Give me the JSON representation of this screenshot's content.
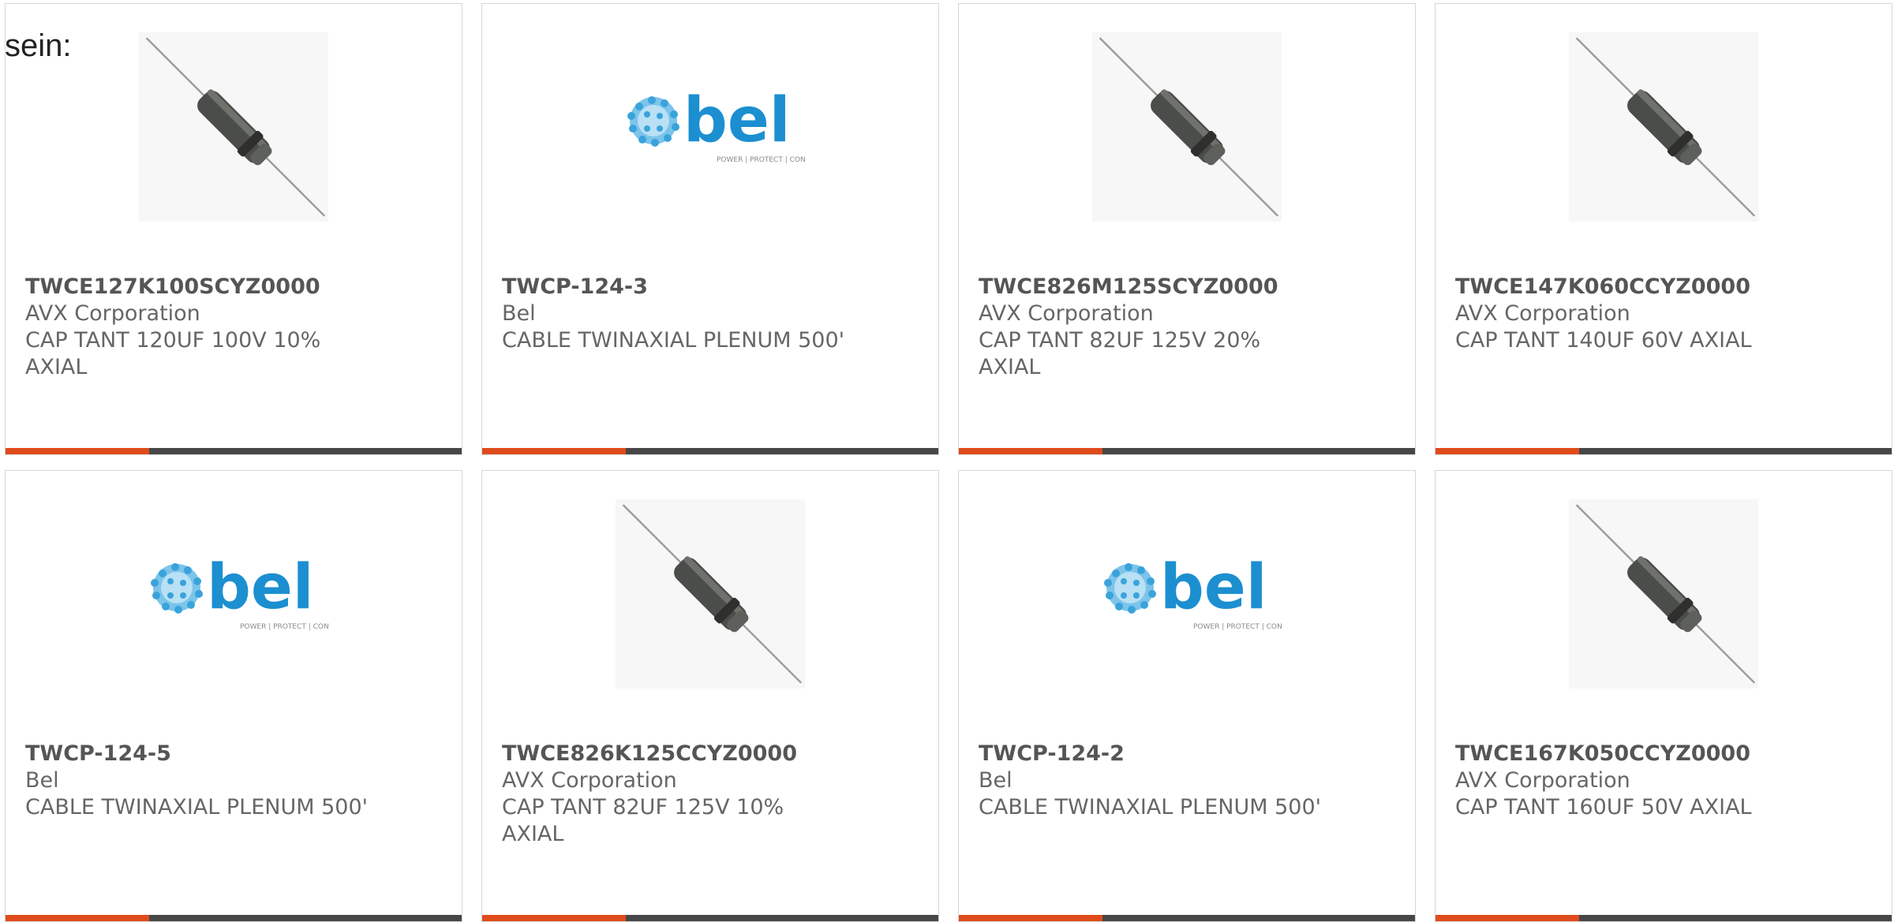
{
  "intro_text": "sein:",
  "colors": {
    "accent": "#e04b1c",
    "bar_dark": "#474747",
    "bel_blue": "#1c8fd1"
  },
  "cards": [
    {
      "part_number": "TWCE127K100SCYZ0000",
      "manufacturer": "AVX Corporation",
      "description": "CAP TANT 120UF 100V 10% AXIAL",
      "image": "axial-capacitor-image"
    },
    {
      "part_number": "TWCP-124-3",
      "manufacturer": "Bel",
      "description": "CABLE TWINAXIAL PLENUM 500'",
      "image": "bel-logo",
      "logo_text": "bel",
      "logo_tagline": "POWER | PROTECT | CONNECT"
    },
    {
      "part_number": "TWCE826M125SCYZ0000",
      "manufacturer": "AVX Corporation",
      "description": "CAP TANT 82UF 125V 20% AXIAL",
      "image": "axial-capacitor-image"
    },
    {
      "part_number": "TWCE147K060CCYZ0000",
      "manufacturer": "AVX Corporation",
      "description": "CAP TANT 140UF 60V AXIAL",
      "image": "axial-capacitor-image"
    },
    {
      "part_number": "TWCP-124-5",
      "manufacturer": "Bel",
      "description": "CABLE TWINAXIAL PLENUM 500'",
      "image": "bel-logo",
      "logo_text": "bel",
      "logo_tagline": "POWER | PROTECT | CONNECT"
    },
    {
      "part_number": "TWCE826K125CCYZ0000",
      "manufacturer": "AVX Corporation",
      "description": "CAP TANT 82UF 125V 10% AXIAL",
      "image": "axial-capacitor-image"
    },
    {
      "part_number": "TWCP-124-2",
      "manufacturer": "Bel",
      "description": "CABLE TWINAXIAL PLENUM 500'",
      "image": "bel-logo",
      "logo_text": "bel",
      "logo_tagline": "POWER | PROTECT | CONNECT"
    },
    {
      "part_number": "TWCE167K050CCYZ0000",
      "manufacturer": "AVX Corporation",
      "description": "CAP TANT 160UF 50V AXIAL",
      "image": "axial-capacitor-image"
    }
  ]
}
